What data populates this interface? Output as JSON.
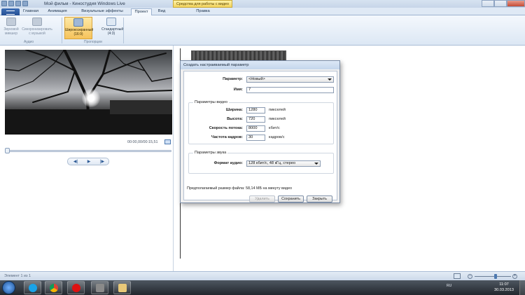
{
  "window": {
    "title": "Мой фильм - Киностудия Windows Live",
    "context_header": "Средства для работы с видео"
  },
  "tabs": [
    "Главная",
    "Анимация",
    "Визуальные эффекты",
    "Проект",
    "Вид",
    "Правка"
  ],
  "active_tab": "Проект",
  "ribbon": {
    "audio_group": {
      "label": "Аудио",
      "buttons": [
        "Звуковой микшер",
        "Синхронизировать с музыкой"
      ]
    },
    "aspect_group": {
      "label": "Пропорции",
      "buttons": [
        "Широкоэкранный (16:9)",
        "Стандартный (4:3)"
      ],
      "selected": "Широкоэкранный (16:9)"
    }
  },
  "preview": {
    "time": "00:00,00/00:15,51",
    "buttons": [
      "◀|",
      "▶",
      "|▶"
    ]
  },
  "dialog": {
    "title": "Создать настраиваемый параметр",
    "param_label": "Параметр:",
    "param_value": "<Новый>",
    "name_label": "Имя:",
    "name_value": "7",
    "video_group": "Параметры видео",
    "width_label": "Ширина:",
    "width_value": "1280",
    "width_unit": "пикселей",
    "height_label": "Высота:",
    "height_value": "720",
    "height_unit": "пикселей",
    "bitrate_label": "Скорость потока:",
    "bitrate_value": "8000",
    "bitrate_unit": "кбит/с",
    "fps_label": "Частота кадров:",
    "fps_value": "30",
    "fps_unit": "кадров/с",
    "audio_group": "Параметры звука",
    "audio_format_label": "Формат аудио:",
    "audio_format_value": "128 кбит/с, 48 кГц, стерео",
    "estimate": "Предполагаемый размер файла: 58,14 МБ на минуту видео",
    "btn_delete": "Удалить",
    "btn_save": "Сохранить",
    "btn_close": "Закрыть"
  },
  "statusbar": {
    "text": "Элемент 1 из 1"
  },
  "taskbar": {
    "lang": "RU",
    "time": "11:07",
    "date": "30.03.2013"
  },
  "colors": {
    "accent": "#f6c35b",
    "ribbon": "#dce7f4",
    "taskbar": "#2b3138"
  }
}
